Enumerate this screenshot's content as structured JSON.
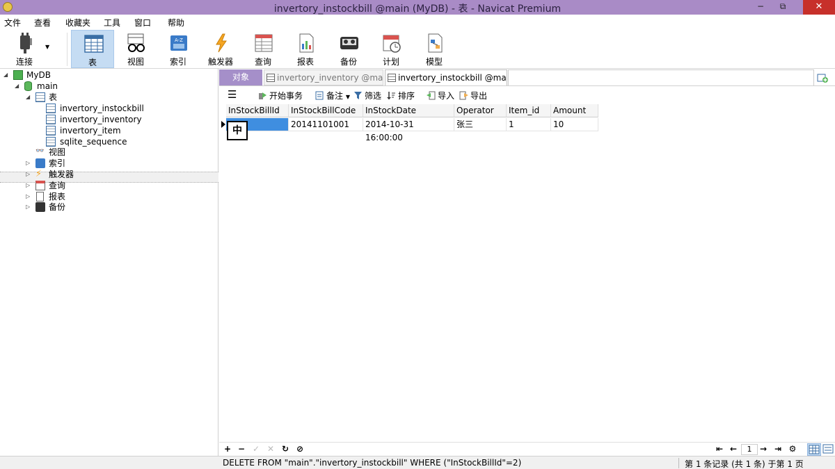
{
  "window": {
    "title": "invertory_instockbill @main (MyDB) - 表 - Navicat Premium",
    "minimize": "−",
    "maximize": "⧉",
    "close": "✕"
  },
  "menu": [
    "文件",
    "查看",
    "收藏夹",
    "工具",
    "窗口",
    "帮助"
  ],
  "toolbar": {
    "connect": "连接",
    "table": "表",
    "view": "视图",
    "index": "索引",
    "trigger": "触发器",
    "query": "查询",
    "report": "报表",
    "backup": "备份",
    "schedule": "计划",
    "model": "模型"
  },
  "tree": {
    "db": "MyDB",
    "schema": "main",
    "tables_group": "表",
    "tables": [
      "invertory_instockbill",
      "invertory_inventory",
      "invertory_item",
      "sqlite_sequence"
    ],
    "views": "视图",
    "indexes": "索引",
    "triggers": "触发器",
    "queries": "查询",
    "reports": "报表",
    "backups": "备份"
  },
  "tabs": {
    "objects": "对象",
    "tab1": "invertory_inventory @main (...",
    "tab2": "invertory_instockbill @main ..."
  },
  "subtoolbar": {
    "begin_tx": "开始事务",
    "memo": "备注",
    "filter": "筛选",
    "sort": "排序",
    "import": "导入",
    "export": "导出"
  },
  "grid": {
    "columns": [
      "InStockBillId",
      "InStockBillCode",
      "InStockDate",
      "Operator",
      "Item_id",
      "Amount"
    ],
    "rows": [
      [
        "",
        "20141101001",
        "2014-10-31 16:00:00",
        "张三",
        "1",
        "10"
      ]
    ]
  },
  "ime_indicator": "中",
  "nav": {
    "add": "+",
    "remove": "−",
    "apply": "✓",
    "discard": "✕",
    "refresh": "↻",
    "stop": "⊘",
    "first": "⇤",
    "prev": "←",
    "page": "1",
    "next": "→",
    "last": "⇥",
    "settings": "⚙"
  },
  "status": {
    "sql": "DELETE FROM \"main\".\"invertory_instockbill\" WHERE (\"InStockBillId\"=2)",
    "records": "第 1 条记录 (共 1 条) 于第 1 页"
  }
}
